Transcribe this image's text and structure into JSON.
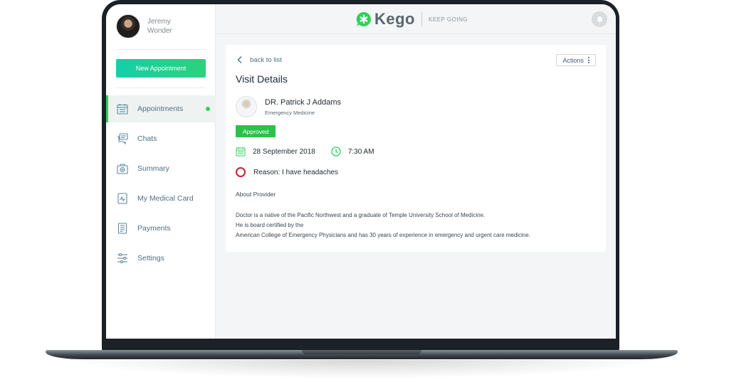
{
  "user": {
    "name": "Jeremy Wonder"
  },
  "sidebar": {
    "new_button": "New Appointment",
    "items": [
      {
        "label": "Appointments",
        "icon": "calendar-icon",
        "active": true
      },
      {
        "label": "Chats",
        "icon": "chat-icon",
        "active": false
      },
      {
        "label": "Summary",
        "icon": "medical-kit-icon",
        "active": false
      },
      {
        "label": "My Medical Card",
        "icon": "medical-card-icon",
        "active": false
      },
      {
        "label": "Payments",
        "icon": "receipt-icon",
        "active": false
      },
      {
        "label": "Settings",
        "icon": "sliders-icon",
        "active": false
      }
    ]
  },
  "header": {
    "brand": "Kego",
    "tagline": "KEEP GOING"
  },
  "visit": {
    "back_label": "back to list",
    "actions_label": "Actions",
    "title": "Visit Details",
    "doctor_name": "DR. Patrick J Addams",
    "doctor_specialty": "Emergency Medicine",
    "status": "Approved",
    "date": "28 September 2018",
    "time": "7:30 AM",
    "reason": "Reason: I have headaches",
    "about_title": "About Provider",
    "about_lines": [
      "Doctor is a native of the Pacific Northwest and a graduate of Temple University School of Medicine.",
      "He is board certified by the",
      "American College of Emergency Physicians and has 30 years of experience in emergency and urgent care medicine."
    ]
  },
  "colors": {
    "accent_green": "#2fd15a",
    "status_green": "#2bc14b",
    "reason_red": "#c9212f",
    "nav_text": "#4e7083"
  }
}
